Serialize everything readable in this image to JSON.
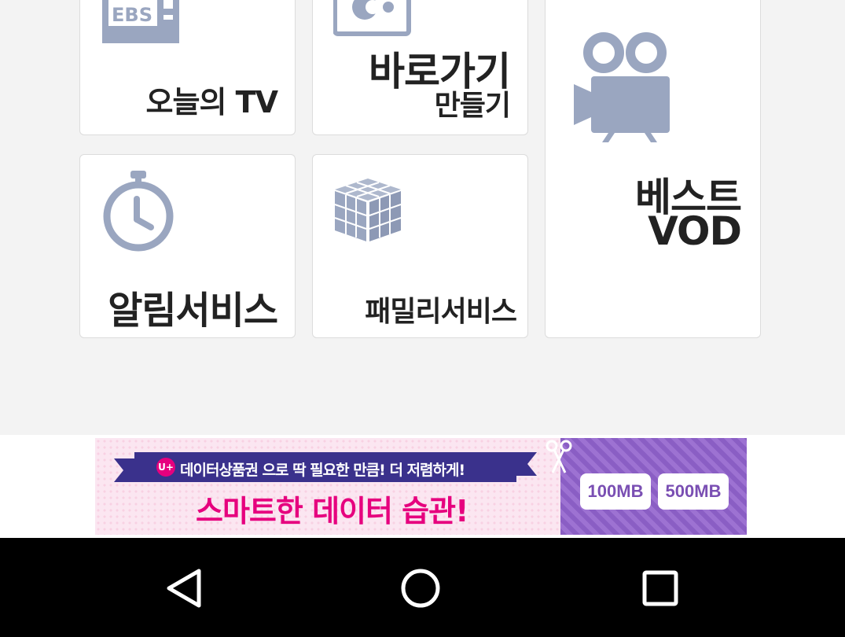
{
  "tiles": {
    "tv": {
      "label": "오늘의 TV",
      "icon": "ebs-tv-icon",
      "icon_text": "EBS"
    },
    "shortcut": {
      "label_line1": "바로가기",
      "label_line2": "만들기",
      "icon": "shortcut-app-icon"
    },
    "vod": {
      "label_line1": "베스트",
      "label_line2": "VOD",
      "icon": "movie-camera-icon"
    },
    "alarm": {
      "label": "알림서비스",
      "icon": "stopwatch-icon"
    },
    "family": {
      "label": "패밀리서비스",
      "icon": "cube-icon"
    }
  },
  "banner": {
    "ribbon_text": "데이터상품권 으로 딱 필요한 만큼! 더 저렴하게!",
    "brand_badge": "U+",
    "headline": "스마트한 데이터 습관!",
    "option_1": "100MB",
    "option_2": "500MB",
    "scissors_icon": "scissors-icon"
  },
  "navbar": {
    "back_icon": "back-triangle-icon",
    "home_icon": "home-circle-icon",
    "recent_icon": "recent-apps-square-icon"
  },
  "colors": {
    "icon_gray_blue": "#9aa6c0",
    "tile_bg": "#ffffff",
    "page_bg": "#f3f3f3",
    "banner_pink": "#e6007e",
    "banner_navy": "#3a318c",
    "banner_purple": "#8a5ec4"
  }
}
